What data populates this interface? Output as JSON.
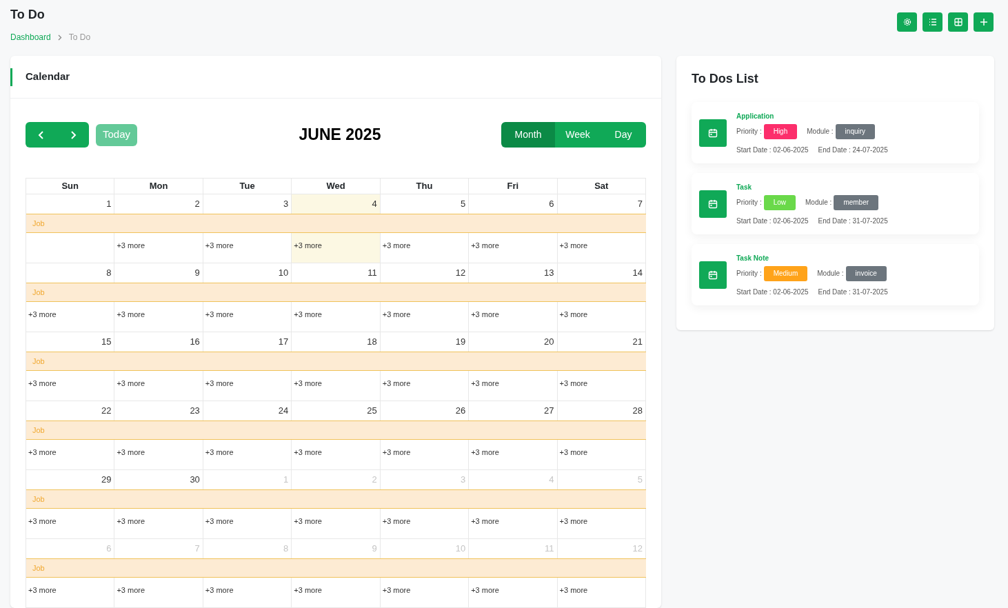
{
  "page": {
    "title": "To Do",
    "breadcrumb": [
      {
        "label": "Dashboard",
        "link": true
      },
      {
        "label": "To Do",
        "link": false
      }
    ]
  },
  "header_buttons": [
    {
      "kind": "settings"
    },
    {
      "kind": "list"
    },
    {
      "kind": "grid"
    },
    {
      "kind": "add"
    }
  ],
  "calendar": {
    "title": "Calendar",
    "today_button": "Today",
    "heading": "JUNE 2025",
    "views": [
      {
        "label": "Month",
        "selected": true
      },
      {
        "label": "Week",
        "selected": false
      },
      {
        "label": "Day",
        "selected": false
      }
    ],
    "weekdays": [
      "Sun",
      "Mon",
      "Tue",
      "Wed",
      "Thu",
      "Fri",
      "Sat"
    ],
    "weeks": [
      {
        "event": "Job",
        "days": [
          {
            "day": "1",
            "outside": false,
            "today": false
          },
          {
            "day": "2",
            "outside": false,
            "today": false,
            "more": "+3 more"
          },
          {
            "day": "3",
            "outside": false,
            "today": false,
            "more": "+3 more"
          },
          {
            "day": "4",
            "outside": false,
            "today": true,
            "more": "+3 more"
          },
          {
            "day": "5",
            "outside": false,
            "today": false,
            "more": "+3 more"
          },
          {
            "day": "6",
            "outside": false,
            "today": false,
            "more": "+3 more"
          },
          {
            "day": "7",
            "outside": false,
            "today": false,
            "more": "+3 more"
          }
        ]
      },
      {
        "event": "Job",
        "days": [
          {
            "day": "8",
            "outside": false,
            "today": false,
            "more": "+3 more"
          },
          {
            "day": "9",
            "outside": false,
            "today": false,
            "more": "+3 more"
          },
          {
            "day": "10",
            "outside": false,
            "today": false,
            "more": "+3 more"
          },
          {
            "day": "11",
            "outside": false,
            "today": false,
            "more": "+3 more"
          },
          {
            "day": "12",
            "outside": false,
            "today": false,
            "more": "+3 more"
          },
          {
            "day": "13",
            "outside": false,
            "today": false,
            "more": "+3 more"
          },
          {
            "day": "14",
            "outside": false,
            "today": false,
            "more": "+3 more"
          }
        ]
      },
      {
        "event": "Job",
        "days": [
          {
            "day": "15",
            "outside": false,
            "today": false,
            "more": "+3 more"
          },
          {
            "day": "16",
            "outside": false,
            "today": false,
            "more": "+3 more"
          },
          {
            "day": "17",
            "outside": false,
            "today": false,
            "more": "+3 more"
          },
          {
            "day": "18",
            "outside": false,
            "today": false,
            "more": "+3 more"
          },
          {
            "day": "19",
            "outside": false,
            "today": false,
            "more": "+3 more"
          },
          {
            "day": "20",
            "outside": false,
            "today": false,
            "more": "+3 more"
          },
          {
            "day": "21",
            "outside": false,
            "today": false,
            "more": "+3 more"
          }
        ]
      },
      {
        "event": "Job",
        "days": [
          {
            "day": "22",
            "outside": false,
            "today": false,
            "more": "+3 more"
          },
          {
            "day": "23",
            "outside": false,
            "today": false,
            "more": "+3 more"
          },
          {
            "day": "24",
            "outside": false,
            "today": false,
            "more": "+3 more"
          },
          {
            "day": "25",
            "outside": false,
            "today": false,
            "more": "+3 more"
          },
          {
            "day": "26",
            "outside": false,
            "today": false,
            "more": "+3 more"
          },
          {
            "day": "27",
            "outside": false,
            "today": false,
            "more": "+3 more"
          },
          {
            "day": "28",
            "outside": false,
            "today": false,
            "more": "+3 more"
          }
        ]
      },
      {
        "event": "Job",
        "days": [
          {
            "day": "29",
            "outside": false,
            "today": false,
            "more": "+3 more"
          },
          {
            "day": "30",
            "outside": false,
            "today": false,
            "more": "+3 more"
          },
          {
            "day": "1",
            "outside": true,
            "today": false,
            "more": "+3 more"
          },
          {
            "day": "2",
            "outside": true,
            "today": false,
            "more": "+3 more"
          },
          {
            "day": "3",
            "outside": true,
            "today": false,
            "more": "+3 more"
          },
          {
            "day": "4",
            "outside": true,
            "today": false,
            "more": "+3 more"
          },
          {
            "day": "5",
            "outside": true,
            "today": false,
            "more": "+3 more"
          }
        ]
      },
      {
        "event": "Job",
        "days": [
          {
            "day": "6",
            "outside": true,
            "today": false,
            "more": "+3 more"
          },
          {
            "day": "7",
            "outside": true,
            "today": false,
            "more": "+3 more"
          },
          {
            "day": "8",
            "outside": true,
            "today": false,
            "more": "+3 more"
          },
          {
            "day": "9",
            "outside": true,
            "today": false,
            "more": "+3 more"
          },
          {
            "day": "10",
            "outside": true,
            "today": false,
            "more": "+3 more"
          },
          {
            "day": "11",
            "outside": true,
            "today": false,
            "more": "+3 more"
          },
          {
            "day": "12",
            "outside": true,
            "today": false,
            "more": "+3 more"
          }
        ]
      }
    ]
  },
  "todos": {
    "title": "To Dos List",
    "items": [
      {
        "title": "Application",
        "priority_label": "Priority :",
        "priority": "High",
        "color": "#fc2e6b",
        "module_label": "Module :",
        "module": "inquiry",
        "start": "Start Date : 02-06-2025",
        "end": "End Date : 24-07-2025"
      },
      {
        "title": "Task",
        "priority_label": "Priority :",
        "priority": "Low",
        "color": "#6ad94a",
        "module_label": "Module :",
        "module": "member",
        "start": "Start Date : 02-06-2025",
        "end": "End Date : 31-07-2025"
      },
      {
        "title": "Task Note",
        "priority_label": "Priority :",
        "priority": "Medium",
        "color": "#ffa31a",
        "module_label": "Module :",
        "module": "invoice",
        "start": "Start Date : 02-06-2025",
        "end": "End Date : 31-07-2025"
      }
    ]
  }
}
